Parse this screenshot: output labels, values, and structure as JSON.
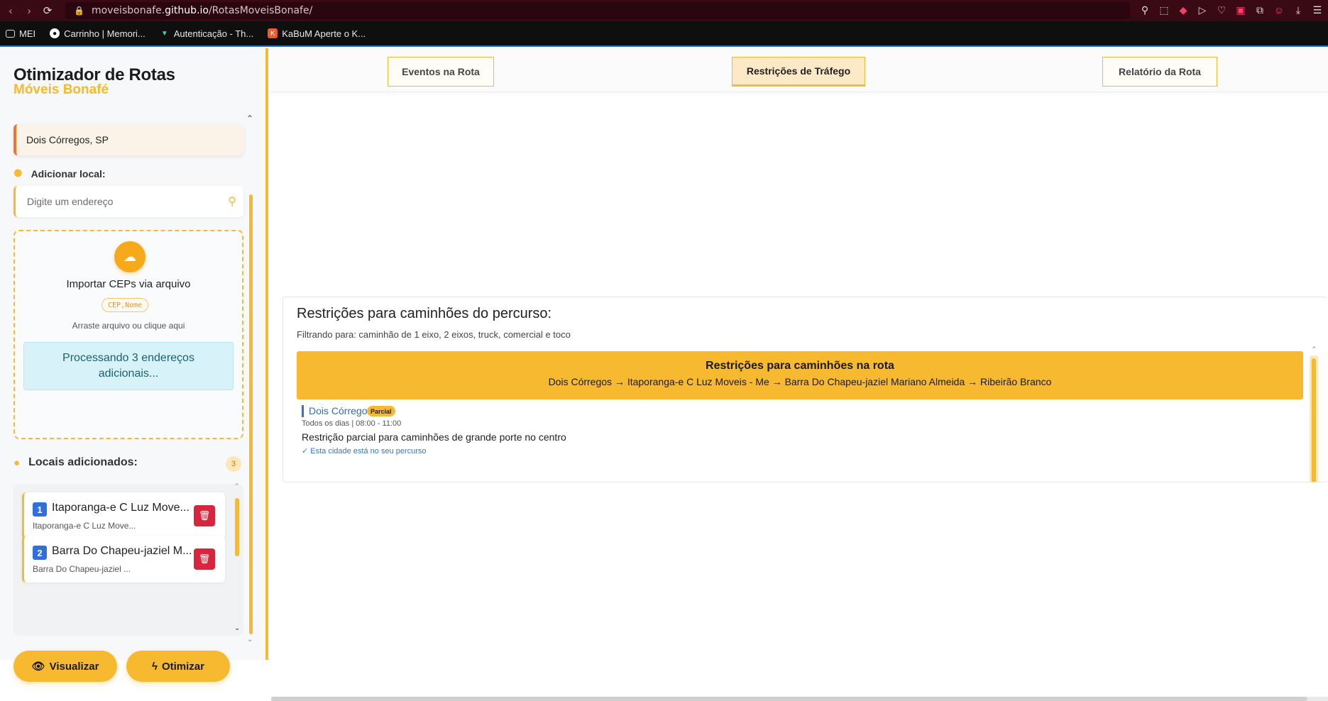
{
  "browser": {
    "url_prefix": "moveisbonafe.",
    "url_domain": "github.io",
    "url_path": "/RotasMoveisBonafe/",
    "bookmarks": [
      {
        "label": "MEI",
        "icon": "folder-icon"
      },
      {
        "label": "Carrinho | Memori...",
        "icon": "site-icon"
      },
      {
        "label": "Autenticação - Th...",
        "icon": "site-icon"
      },
      {
        "label": "KaBuM Aperte o K...",
        "icon": "site-icon"
      }
    ]
  },
  "sidebar": {
    "title": "Otimizador de Rotas",
    "subtitle": "Móveis Bonafé",
    "origin": "Dois Córregos, SP",
    "add_label": "Adicionar local:",
    "search_placeholder": "Digite um endereço",
    "import": {
      "title": "Importar CEPs via arquivo",
      "format": "CEP,Nome",
      "hint": "Arraste arquivo ou clique aqui",
      "processing": "Processando 3 endereços adicionais..."
    },
    "locais_label": "Locais adicionados:",
    "locais_count": "3",
    "locais": [
      {
        "num": "1",
        "name": "Itaporanga-e C Luz Move...",
        "address": "Itaporanga-e C Luz Move..."
      },
      {
        "num": "2",
        "name": "Barra Do Chapeu-jaziel M...",
        "address": "Barra Do Chapeu-jaziel ..."
      }
    ],
    "btn_visualizar": "Visualizar",
    "btn_otimizar": "Otimizar"
  },
  "tabs": [
    {
      "label": "Eventos na Rota",
      "active": false
    },
    {
      "label": "Restrições de Tráfego",
      "active": true
    },
    {
      "label": "Relatório da Rota",
      "active": false
    }
  ],
  "restrictions": {
    "title": "Restrições para caminhões do percurso:",
    "filter": "Filtrando para: caminhão de 1 eixo, 2 eixos, truck, comercial e toco",
    "banner_title": "Restrições para caminhões na rota",
    "banner_path": "Dois Córregos → Itaporanga-e C Luz Moveis - Me → Barra Do Chapeu-jaziel Mariano Almeida → Ribeirão Branco",
    "items": [
      {
        "city": "Dois Córregos",
        "badge": "Parcial",
        "time": "Todos os dias | 08:00 - 11:00",
        "description": "Restrição parcial para caminhões de grande porte no centro",
        "note": "✓ Esta cidade está no seu percurso"
      }
    ]
  },
  "colors": {
    "accent": "#f6b930",
    "accent_dark": "#f6a91b",
    "origin_border": "#f0752a",
    "number_badge": "#2f6fde",
    "delete": "#d7263d",
    "browser_bar": "#3a0a14"
  }
}
